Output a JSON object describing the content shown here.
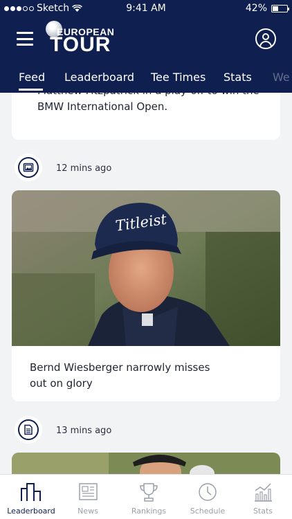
{
  "status_bar": {
    "carrier": "Sketch",
    "time": "9:41 AM",
    "battery": "42%",
    "battery_fraction": 0.42
  },
  "header": {
    "logo_line1": "EUROPEAN",
    "logo_line2": "TOUR"
  },
  "tabs": [
    {
      "label": "Feed",
      "active": true
    },
    {
      "label": "Leaderboard"
    },
    {
      "label": "Tee Times"
    },
    {
      "label": "Stats"
    },
    {
      "label": "We"
    }
  ],
  "feed": {
    "partial_card_text": "Matthew Fitzpatrick in a play-off to win the BMW International Open.",
    "items": [
      {
        "type": "gallery",
        "time": "12 mins ago",
        "headline": "Bernd Wiesberger narrowly misses out on glory"
      },
      {
        "type": "article",
        "time": "13 mins ago"
      }
    ]
  },
  "tabbar": [
    {
      "label": "Leaderboard",
      "icon": "leaderboard-icon",
      "active": true
    },
    {
      "label": "News",
      "icon": "news-icon"
    },
    {
      "label": "Rankings",
      "icon": "trophy-icon"
    },
    {
      "label": "Schedule",
      "icon": "clock-icon"
    },
    {
      "label": "Stats",
      "icon": "stats-chart-icon"
    }
  ],
  "colors": {
    "navy": "#0f1f4f",
    "background": "#f2f3f5",
    "inactive": "#9aa0ab"
  }
}
